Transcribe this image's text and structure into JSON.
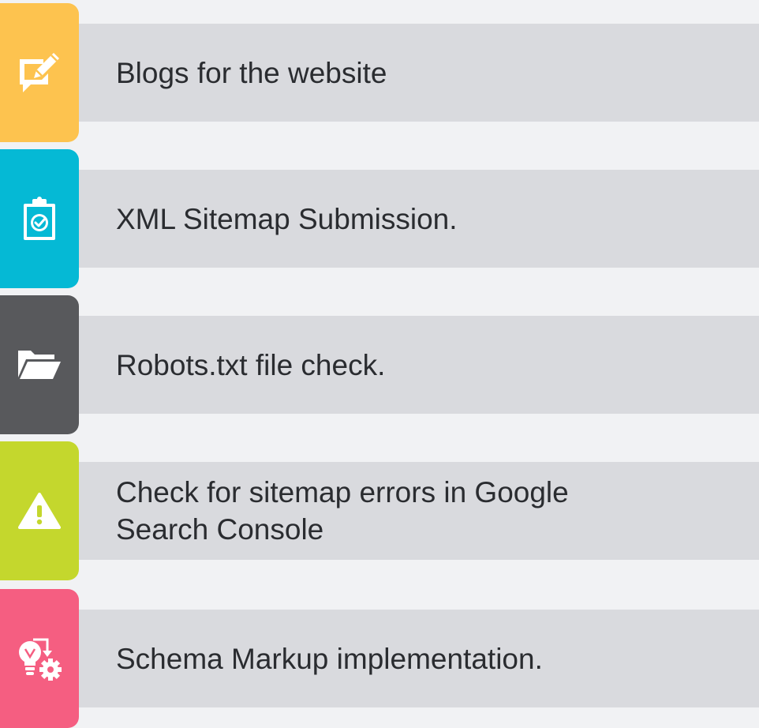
{
  "items": [
    {
      "text": "Blogs for the website",
      "color": "#fdc34f",
      "icon": "edit-comment-icon"
    },
    {
      "text": "XML Sitemap Submission.",
      "color": "#05b9d5",
      "icon": "clipboard-check-icon"
    },
    {
      "text": "Robots.txt file check.",
      "color": "#58595c",
      "icon": "open-folder-icon"
    },
    {
      "text": "Check for sitemap errors in Google Search Console",
      "line1": "Check for sitemap errors in Google",
      "line2": "Search Console",
      "color": "#c4d72d",
      "icon": "warning-icon"
    },
    {
      "text": "Schema Markup implementation.",
      "color": "#f55e81",
      "icon": "idea-gear-icon"
    }
  ]
}
